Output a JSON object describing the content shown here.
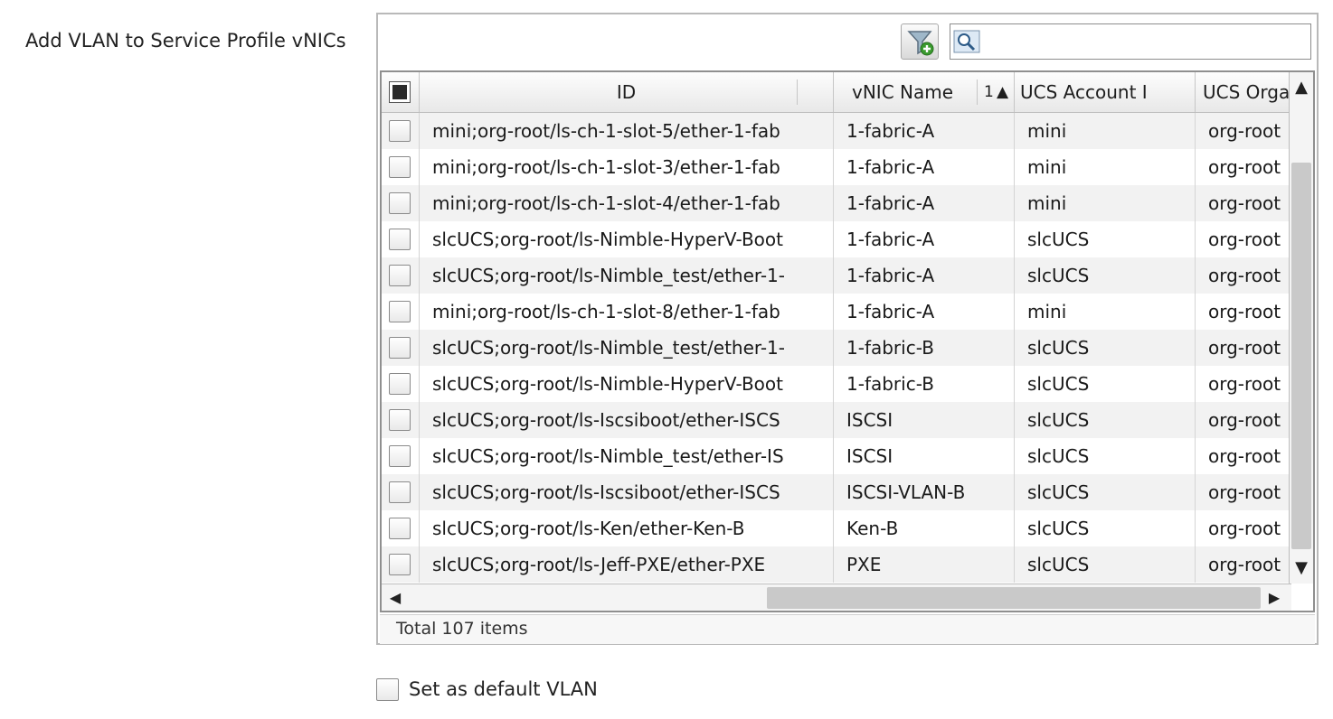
{
  "field_label": "Add VLAN to Service Profile vNICs",
  "toolbar": {
    "filter_icon": "add-filter-icon",
    "search_icon": "search-icon",
    "search_value": ""
  },
  "columns": [
    "ID",
    "vNIC Name",
    "UCS Account I",
    "UCS Orga"
  ],
  "sort": {
    "order": "1",
    "direction": "▲"
  },
  "rows": [
    {
      "id": "mini;org-root/ls-ch-1-slot-5/ether-1-fab",
      "vnic": "1-fabric-A",
      "account": "mini",
      "org": "org-root"
    },
    {
      "id": "mini;org-root/ls-ch-1-slot-3/ether-1-fab",
      "vnic": "1-fabric-A",
      "account": "mini",
      "org": "org-root"
    },
    {
      "id": "mini;org-root/ls-ch-1-slot-4/ether-1-fab",
      "vnic": "1-fabric-A",
      "account": "mini",
      "org": "org-root"
    },
    {
      "id": "slcUCS;org-root/ls-Nimble-HyperV-Boot",
      "vnic": "1-fabric-A",
      "account": "slcUCS",
      "org": "org-root"
    },
    {
      "id": "slcUCS;org-root/ls-Nimble_test/ether-1-",
      "vnic": "1-fabric-A",
      "account": "slcUCS",
      "org": "org-root"
    },
    {
      "id": "mini;org-root/ls-ch-1-slot-8/ether-1-fab",
      "vnic": "1-fabric-A",
      "account": "mini",
      "org": "org-root"
    },
    {
      "id": "slcUCS;org-root/ls-Nimble_test/ether-1-",
      "vnic": "1-fabric-B",
      "account": "slcUCS",
      "org": "org-root"
    },
    {
      "id": "slcUCS;org-root/ls-Nimble-HyperV-Boot",
      "vnic": "1-fabric-B",
      "account": "slcUCS",
      "org": "org-root"
    },
    {
      "id": "slcUCS;org-root/ls-Iscsiboot/ether-ISCS",
      "vnic": "ISCSI",
      "account": "slcUCS",
      "org": "org-root"
    },
    {
      "id": "slcUCS;org-root/ls-Nimble_test/ether-IS",
      "vnic": "ISCSI",
      "account": "slcUCS",
      "org": "org-root"
    },
    {
      "id": "slcUCS;org-root/ls-Iscsiboot/ether-ISCS",
      "vnic": "ISCSI-VLAN-B",
      "account": "slcUCS",
      "org": "org-root"
    },
    {
      "id": "slcUCS;org-root/ls-Ken/ether-Ken-B",
      "vnic": "Ken-B",
      "account": "slcUCS",
      "org": "org-root"
    },
    {
      "id": "slcUCS;org-root/ls-Jeff-PXE/ether-PXE",
      "vnic": "PXE",
      "account": "slcUCS",
      "org": "org-root"
    }
  ],
  "footer": {
    "total": "Total 107 items"
  },
  "default_vlan_label": "Set as default VLAN"
}
